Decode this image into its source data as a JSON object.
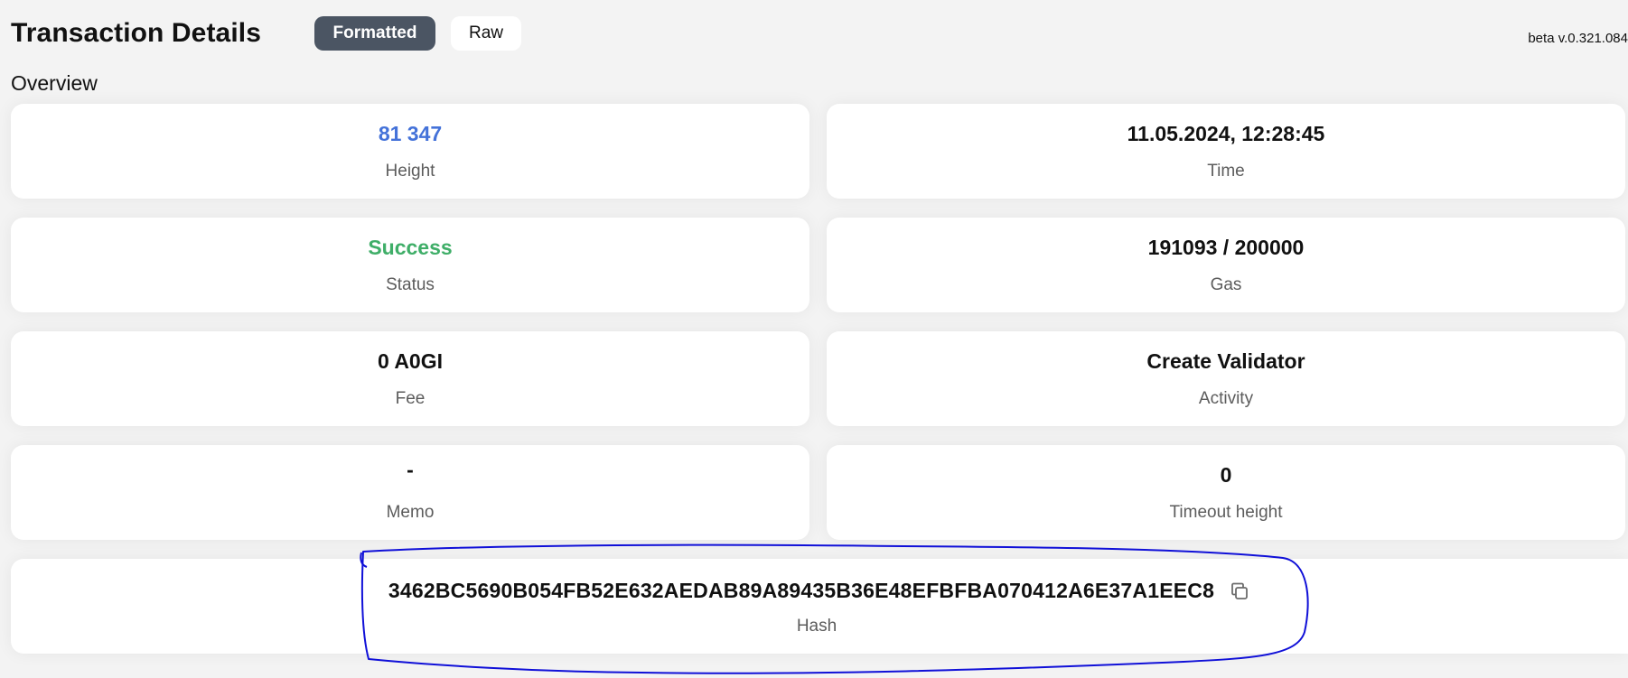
{
  "header": {
    "title": "Transaction Details",
    "tabs": [
      {
        "label": "Formatted",
        "active": true
      },
      {
        "label": "Raw",
        "active": false
      }
    ],
    "version": "beta v.0.321.084"
  },
  "overview": {
    "heading": "Overview",
    "height": {
      "value": "81 347",
      "label": "Height"
    },
    "time": {
      "value": "11.05.2024, 12:28:45",
      "label": "Time"
    },
    "status": {
      "value": "Success",
      "label": "Status"
    },
    "gas": {
      "value": "191093 / 200000",
      "label": "Gas"
    },
    "fee": {
      "value": "0 A0GI",
      "label": "Fee"
    },
    "activity": {
      "value": "Create Validator",
      "label": "Activity"
    },
    "memo": {
      "value": "-",
      "label": "Memo"
    },
    "timeout_height": {
      "value": "0",
      "label": "Timeout height"
    },
    "hash": {
      "value": "3462BC5690B054FB52E632AEDAB89A89435B36E48EFBFBA070412A6E37A1EEC8",
      "label": "Hash",
      "icon": "copy-icon"
    }
  },
  "colors": {
    "accent_blue": "#4472d9",
    "success_green": "#3fae68",
    "active_tab": "#4b5563",
    "annotation_stroke": "#1010d8"
  }
}
